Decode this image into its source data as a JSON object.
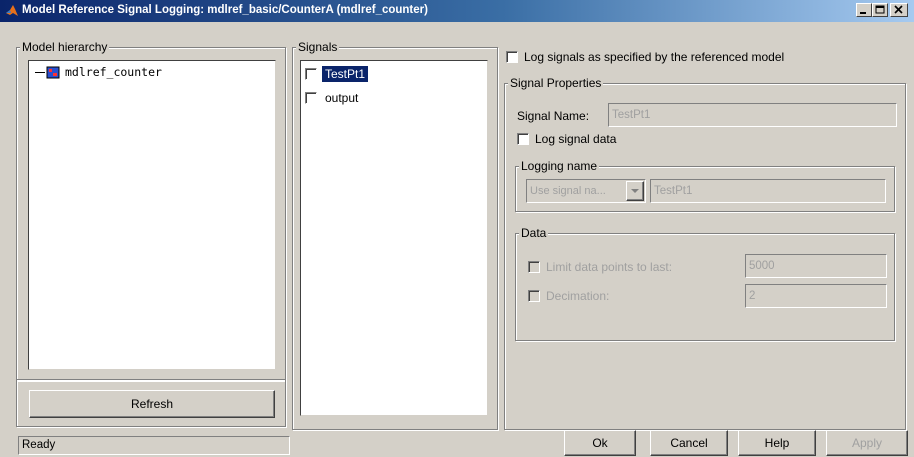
{
  "window": {
    "title": "Model Reference Signal Logging: mdlref_basic/CounterA (mdlref_counter)"
  },
  "hierarchy": {
    "legend": "Model hierarchy",
    "root": "mdlref_counter",
    "refresh_label": "Refresh"
  },
  "signals": {
    "legend": "Signals",
    "items": [
      {
        "label": "TestPt1",
        "checked": false,
        "selected": true
      },
      {
        "label": "output",
        "checked": false,
        "selected": false
      }
    ]
  },
  "log_as_specified_label": "Log signals as specified by the referenced model",
  "signal_properties": {
    "legend": "Signal Properties",
    "signal_name_label": "Signal Name:",
    "signal_name_value": "TestPt1",
    "log_signal_data_label": "Log signal data",
    "logging_name": {
      "legend": "Logging name",
      "select_value": "Use signal na...",
      "name_value": "TestPt1"
    },
    "data": {
      "legend": "Data",
      "limit_label": "Limit data points to last:",
      "limit_value": "5000",
      "decimation_label": "Decimation:",
      "decimation_value": "2"
    }
  },
  "status": {
    "text": "Ready"
  },
  "buttons": {
    "ok": "Ok",
    "cancel": "Cancel",
    "help": "Help",
    "apply": "Apply"
  },
  "colors": {
    "title_start": "#0a246a",
    "title_end": "#a6caf0",
    "face": "#d4d0c8",
    "selection": "#0a246a"
  }
}
